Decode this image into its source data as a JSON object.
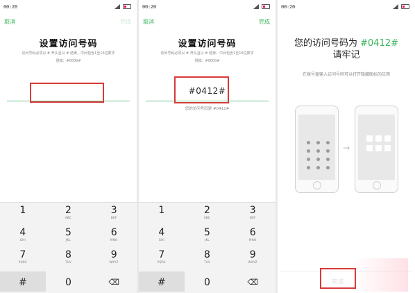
{
  "status_time": "00:20",
  "status_icons": [
    "signal-icon",
    "wifi-icon",
    "battery-icon"
  ],
  "screen1": {
    "cancel": "取消",
    "done": "完成",
    "title": "设置访问号码",
    "hint_line1": "访问号码必须以 # 开头且以 # 结束，中间包含1至16位数字",
    "hint_line2": "例如：#0000#"
  },
  "screen2": {
    "cancel": "取消",
    "done": "完成",
    "title": "设置访问号码",
    "hint_line1": "访问号码必须以 # 开头且以 # 结束，中间包含1至16位数字",
    "hint_line2": "例如：#0000#",
    "entered_value": "#0412#",
    "confirm_note": "您的访问号码是 #0412#"
  },
  "keypad": [
    {
      "digit": "1",
      "letters": ""
    },
    {
      "digit": "2",
      "letters": "ABC"
    },
    {
      "digit": "3",
      "letters": "DEF"
    },
    {
      "digit": "4",
      "letters": "GHI"
    },
    {
      "digit": "5",
      "letters": "JKL"
    },
    {
      "digit": "6",
      "letters": "MNO"
    },
    {
      "digit": "7",
      "letters": "PQRS"
    },
    {
      "digit": "8",
      "letters": "TUV"
    },
    {
      "digit": "9",
      "letters": "WXYZ"
    },
    {
      "digit": "#",
      "letters": ""
    },
    {
      "digit": "0",
      "letters": ""
    },
    {
      "digit": "⌫",
      "letters": ""
    }
  ],
  "screen3": {
    "title_prefix": "您的访问号码为",
    "code": "#0412#",
    "title_line2": "请牢记",
    "sub_hint": "在拨号盘输入访问号码可以打开隐藏图标的应用",
    "done": "完成"
  },
  "colors": {
    "accent": "#39b45a",
    "highlight_box": "#d93a3a",
    "keypad_bg": "#f3f3f3"
  }
}
